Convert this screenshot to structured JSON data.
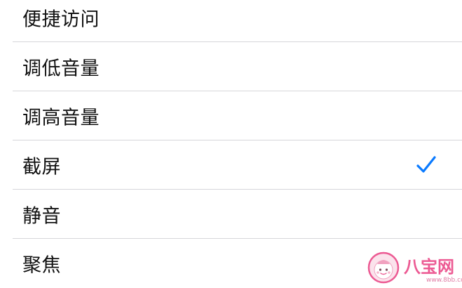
{
  "settings_list": {
    "items": [
      {
        "label": "便捷访问",
        "checked": false
      },
      {
        "label": "调低音量",
        "checked": false
      },
      {
        "label": "调高音量",
        "checked": false
      },
      {
        "label": "截屏",
        "checked": true
      },
      {
        "label": "静音",
        "checked": false
      },
      {
        "label": "聚焦",
        "checked": false
      }
    ]
  },
  "colors": {
    "accent": "#0a7aff",
    "separator": "#d6d6da",
    "text": "#111111",
    "watermark": "#ec5a93"
  },
  "watermark": {
    "text": "八宝网",
    "url": "www.8bb.com",
    "icon": "baby-face-icon"
  }
}
